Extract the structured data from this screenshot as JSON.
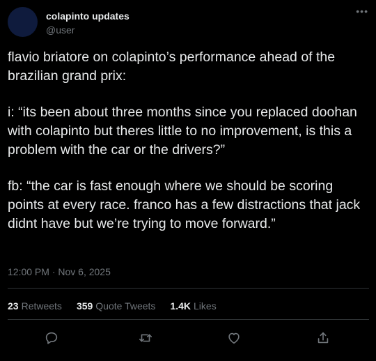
{
  "author": {
    "name": "colapinto updates",
    "handle": "@user",
    "more_icon": "more-horizontal-icon"
  },
  "tweet": {
    "paragraphs": [
      "flavio briatore on colapinto’s performance ahead of the brazilian grand prix:",
      "i: “its been about three months since you replaced doohan with colapinto but theres little to no improvement, is this a problem with the car or the drivers?”",
      "fb: “the car is fast enough where we should be scoring points at every race. franco has a few distractions that jack didnt have but we’re trying to move forward.”"
    ],
    "timestamp": "12:00 PM · Nov 6, 2025"
  },
  "stats": {
    "retweets_count": "23",
    "retweets_label": "Retweets",
    "quotes_count": "359",
    "quotes_label": "Quote Tweets",
    "likes_count": "1.4K",
    "likes_label": "Likes"
  },
  "actions": [
    "reply-icon",
    "retweet-icon",
    "like-icon",
    "share-icon"
  ],
  "colors": {
    "background": "#000000",
    "text": "#e7e9ea",
    "secondary": "#71767b",
    "divider": "#2f3336",
    "avatar": "#0f1b3d"
  }
}
